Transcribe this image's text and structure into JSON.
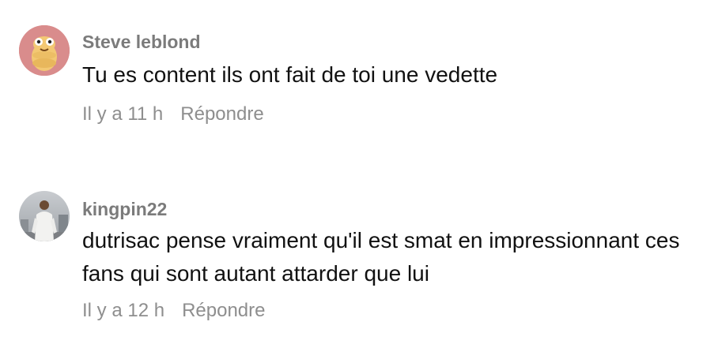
{
  "comments": [
    {
      "username": "Steve leblond",
      "avatar_icon": "cartoon-cookie-avatar",
      "text": "Tu es content ils ont fait de toi une vedette",
      "time": "Il y a 11 h",
      "reply_label": "Répondre"
    },
    {
      "username": "kingpin22",
      "avatar_icon": "person-photo-avatar",
      "text": "dutrisac pense vraiment qu'il est smat en impressionnant ces fans qui sont autant attarder que lui",
      "time": "Il y a 12 h",
      "reply_label": "Répondre"
    }
  ],
  "colors": {
    "username": "#7b7b7b",
    "text": "#111111",
    "meta": "#8e8e8e",
    "avatar1_bg": "#d98c8c"
  }
}
